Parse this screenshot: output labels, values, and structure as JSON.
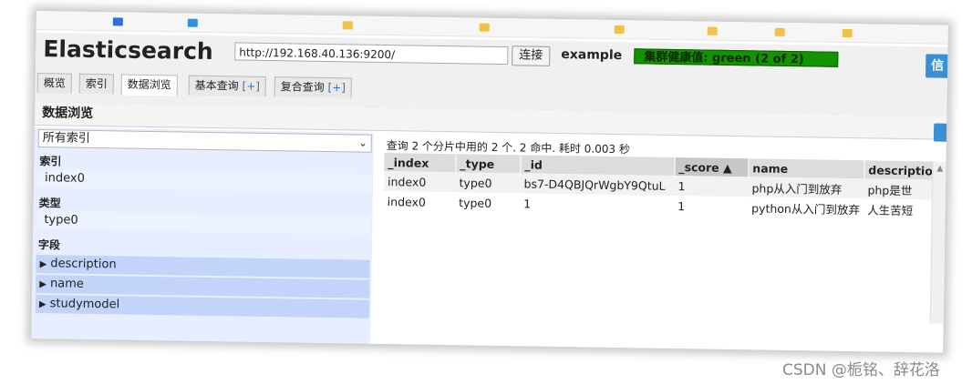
{
  "app": {
    "title": "Elasticsearch",
    "url": "http://192.168.40.136:9200/",
    "connect_label": "连接",
    "cluster_name": "example",
    "health": "集群健康值: green (2 of 2)",
    "info_label": "信"
  },
  "tabs": [
    {
      "label": "概览"
    },
    {
      "label": "索引"
    },
    {
      "label": "数据浏览"
    },
    {
      "label": "基本查询",
      "plus": "[+]"
    },
    {
      "label": "复合查询",
      "plus": "[+]"
    }
  ],
  "section_title": "数据浏览",
  "filters": {
    "index_select": "所有索引",
    "index_label": "索引",
    "index_value": "index0",
    "type_label": "类型",
    "type_value": "type0",
    "fields_label": "字段",
    "fields": [
      "description",
      "name",
      "studymodel"
    ]
  },
  "results": {
    "summary": "查询 2 个分片中用的 2 个. 2 命中. 耗时 0.003 秒",
    "columns": [
      "_index",
      "_type",
      "_id",
      "_score ▲",
      "name",
      "descriptio"
    ],
    "rows": [
      [
        "index0",
        "type0",
        "bs7-D4QBJQrWgbY9QtuL",
        "1",
        "php从入门到放弃",
        "php是世"
      ],
      [
        "index0",
        "type0",
        "1",
        "1",
        "python从入门到放弃",
        "人生苦短"
      ]
    ]
  },
  "watermark": "CSDN @栀铭、辞花洛",
  "colors": {
    "health_bg": "#139300",
    "panel_bg": "#e6eeff",
    "field_bg": "#c3d4fb",
    "accent": "#3a8fd4"
  }
}
